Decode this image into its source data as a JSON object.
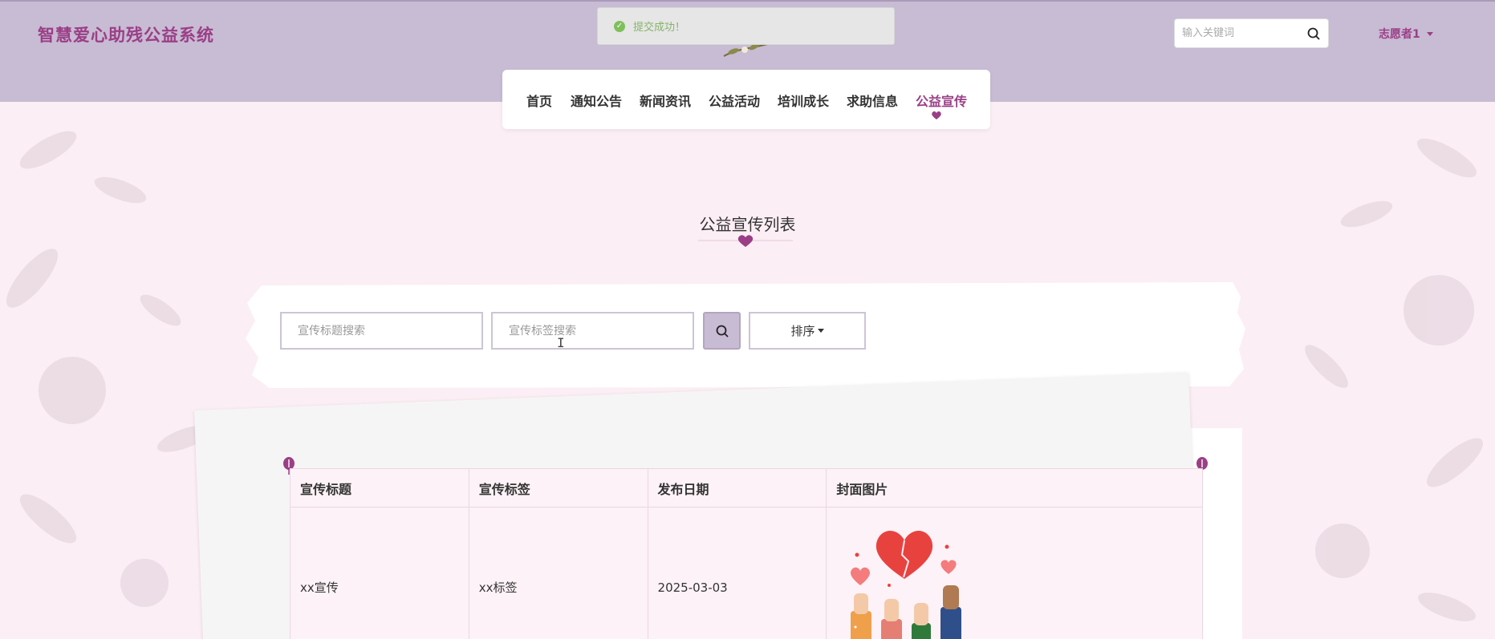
{
  "header": {
    "site_title": "智慧爱心助残公益系统",
    "search_placeholder": "输入关键词",
    "user_name": "志愿者1"
  },
  "toast": {
    "message": "提交成功！",
    "type": "success"
  },
  "nav": {
    "items": [
      {
        "label": "首页"
      },
      {
        "label": "通知公告"
      },
      {
        "label": "新闻资讯"
      },
      {
        "label": "公益活动"
      },
      {
        "label": "培训成长"
      },
      {
        "label": "求助信息"
      },
      {
        "label": "公益宣传",
        "active": true
      }
    ]
  },
  "page": {
    "title": "公益宣传列表"
  },
  "filters": {
    "title_placeholder": "宣传标题搜索",
    "tag_placeholder": "宣传标签搜索",
    "sort_label": "排序"
  },
  "table": {
    "columns": [
      "宣传标题",
      "宣传标签",
      "发布日期",
      "封面图片"
    ],
    "rows": [
      {
        "title": "xx宣传",
        "tag": "xx标签",
        "date": "2025-03-03",
        "cover": "hands-with-hearts-illustration"
      }
    ]
  },
  "colors": {
    "brand": "#9a3f86",
    "header_bg": "#c8bbd4",
    "page_bg": "#fbeef4",
    "success": "#7fbf5b"
  }
}
